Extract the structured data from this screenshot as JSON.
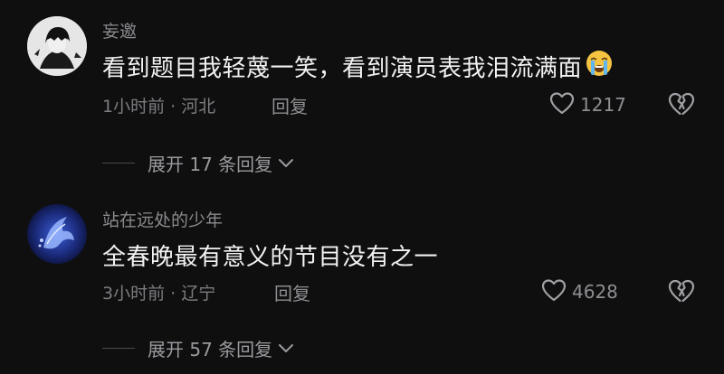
{
  "comments": [
    {
      "username": "妄邀",
      "text": "看到题目我轻蔑一笑，看到演员表我泪流满面",
      "emoji": "loudly-crying-face",
      "time_location": "1小时前 · 河北",
      "reply_label": "回复",
      "like_count": "1217",
      "expand_label": "展开 17 条回复"
    },
    {
      "username": "站在远处的少年",
      "text": "全春晚最有意义的节目没有之一",
      "time_location": "3小时前 · 辽宁",
      "reply_label": "回复",
      "like_count": "4628",
      "expand_label": "展开 57 条回复"
    }
  ],
  "icons": {
    "like": "heart-outline-icon",
    "dislike": "broken-heart-icon",
    "expand": "chevron-down-icon"
  },
  "colors": {
    "background": "#0f0f10",
    "primary_text": "#f2f2f3",
    "secondary_text": "#8a8a8d"
  }
}
